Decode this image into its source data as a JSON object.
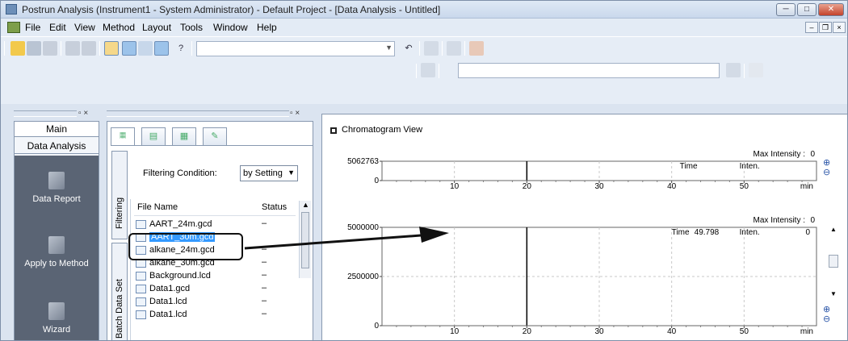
{
  "window": {
    "title": "Postrun Analysis (Instrument1 - System Administrator) - Default Project - [Data Analysis - Untitled]",
    "minimize": "─",
    "maximize": "□",
    "close": "✕"
  },
  "menu": {
    "items": [
      "File",
      "Edit",
      "View",
      "Method",
      "Layout",
      "Tools",
      "Window",
      "Help"
    ],
    "mdi_min": "–",
    "mdi_restore": "❐",
    "mdi_close": "×"
  },
  "icons": {
    "toolbar1": [
      "folder-open-icon",
      "save-icon",
      "copy-icon",
      "print-icon",
      "print-preview-icon",
      "layout-icon",
      "window-icon",
      "table-icon",
      "chart-icon",
      "help-icon"
    ],
    "toolbar1_b": [
      "undo-icon",
      "edit-icon",
      "report-icon",
      "export-icon"
    ],
    "toolbar2": [
      "pin-icon",
      "peak-integrate-icon",
      "peak-detect-icon"
    ]
  },
  "help_glyph": "?",
  "nav": {
    "tabs": [
      "Main",
      "Data Analysis"
    ],
    "buttons": [
      "Data Report",
      "Apply to Method",
      "Wizard"
    ]
  },
  "data_pane": {
    "filtering_label": "Filtering Condition:",
    "filter_value": "by Setting",
    "vtabs": [
      "Filtering",
      "Batch Data Set"
    ],
    "columns": [
      "File Name",
      "Status"
    ],
    "files": [
      {
        "name": "AART_24m.gcd",
        "status": "–"
      },
      {
        "name": "AART_30m.gcd",
        "status": "",
        "selected": true
      },
      {
        "name": "alkane_24m.gcd",
        "status": "–"
      },
      {
        "name": "alkane_30m.gcd",
        "status": "–"
      },
      {
        "name": "Background.lcd",
        "status": "–"
      },
      {
        "name": "Data1.gcd",
        "status": "–"
      },
      {
        "name": "Data1.lcd",
        "status": "–"
      },
      {
        "name": "Data1.lcd",
        "status": "–"
      }
    ]
  },
  "chart_view": {
    "title": "Chromatogram View"
  },
  "chart_data": [
    {
      "type": "line",
      "ylim": [
        0,
        5062763
      ],
      "xlim": [
        0,
        60
      ],
      "y_ticks": [
        "5062763",
        "0"
      ],
      "x_ticks": [
        "10",
        "20",
        "30",
        "40",
        "50",
        "min"
      ],
      "max_intensity_label": "Max Intensity :",
      "max_intensity_value": "0",
      "time_label": "Time",
      "inten_label": "Inten."
    },
    {
      "type": "line",
      "ylim": [
        0,
        5000000
      ],
      "xlim": [
        0,
        60
      ],
      "y_ticks": [
        "5000000",
        "2500000",
        "0"
      ],
      "x_ticks": [
        "10",
        "20",
        "30",
        "40",
        "50",
        "min"
      ],
      "max_intensity_label": "Max Intensity :",
      "max_intensity_value": "0",
      "time_label": "Time",
      "time_value": "49.798",
      "inten_label": "Inten.",
      "inten_value": "0"
    }
  ]
}
